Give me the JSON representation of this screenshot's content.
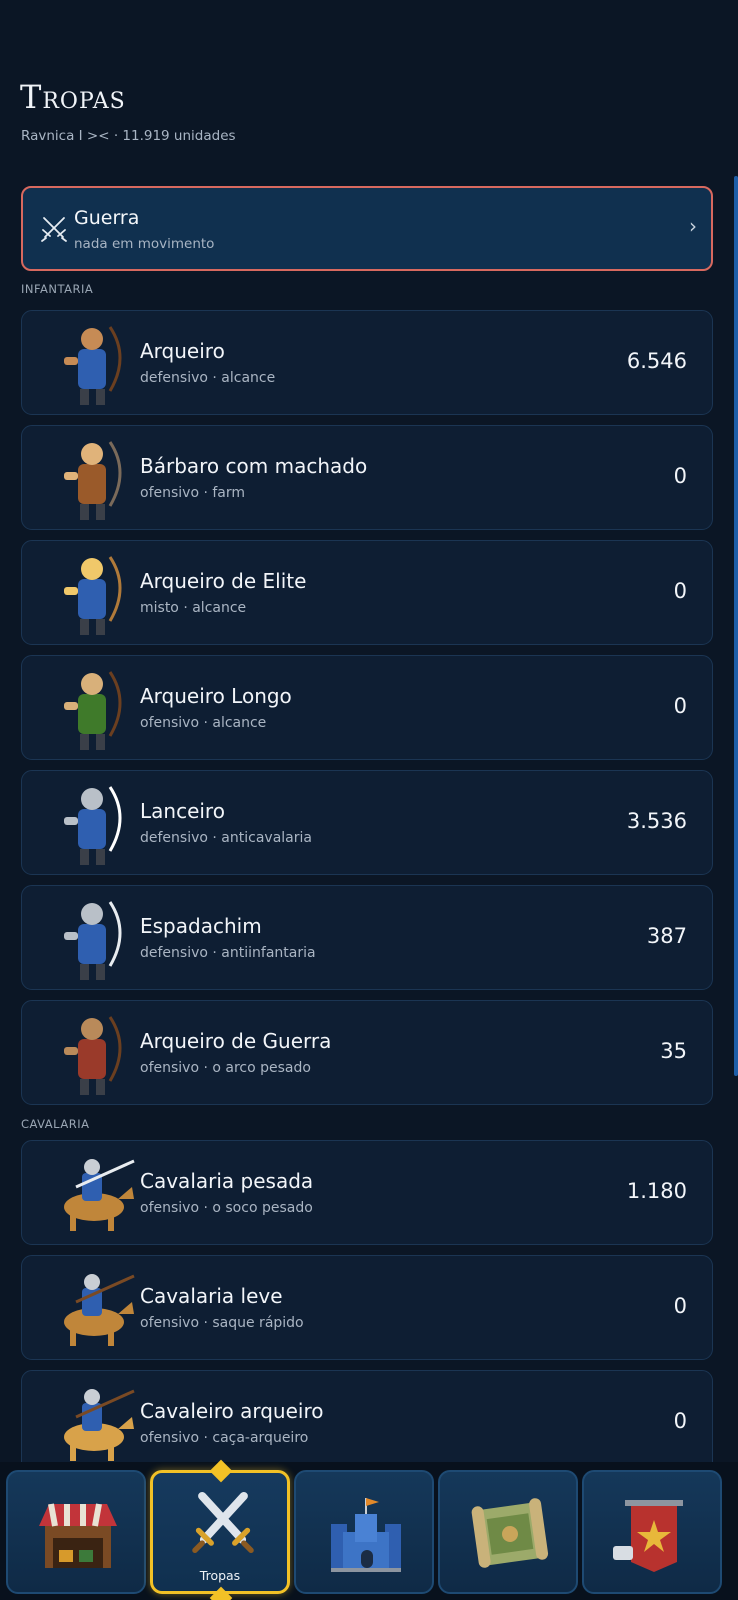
{
  "header": {
    "title": "Tropas",
    "subtitle": "Ravnica I >< · 11.919 unidades"
  },
  "war": {
    "title": "Guerra",
    "subtitle": "nada em movimento",
    "icon": "crossed-swords-icon"
  },
  "sections": {
    "infantry": "INFANTARIA",
    "cavalry": "CAVALARIA"
  },
  "troops": [
    {
      "name": "Arqueiro",
      "desc": "defensivo · alcance",
      "count": "6.546",
      "icon": "archer-icon"
    },
    {
      "name": "Bárbaro com machado",
      "desc": "ofensivo · farm",
      "count": "0",
      "icon": "axe-barbarian-icon"
    },
    {
      "name": "Arqueiro de Elite",
      "desc": "misto · alcance",
      "count": "0",
      "icon": "elite-archer-icon"
    },
    {
      "name": "Arqueiro Longo",
      "desc": "ofensivo · alcance",
      "count": "0",
      "icon": "longbow-archer-icon"
    },
    {
      "name": "Lanceiro",
      "desc": "defensivo · anticavalaria",
      "count": "3.536",
      "icon": "spearman-icon"
    },
    {
      "name": "Espadachim",
      "desc": "defensivo · antiinfantaria",
      "count": "387",
      "icon": "swordsman-icon"
    },
    {
      "name": "Arqueiro de Guerra",
      "desc": "ofensivo · o arco pesado",
      "count": "35",
      "icon": "war-archer-icon"
    },
    {
      "name": "Cavalaria pesada",
      "desc": "ofensivo · o soco pesado",
      "count": "1.180",
      "icon": "heavy-cavalry-icon"
    },
    {
      "name": "Cavalaria leve",
      "desc": "ofensivo · saque rápido",
      "count": "0",
      "icon": "light-cavalry-icon"
    },
    {
      "name": "Cavaleiro arqueiro",
      "desc": "ofensivo · caça-arqueiro",
      "count": "0",
      "icon": "horse-archer-icon"
    }
  ],
  "nav": [
    {
      "label": "",
      "icon": "market-icon"
    },
    {
      "label": "Tropas",
      "icon": "crossed-swords-icon",
      "active": true
    },
    {
      "label": "",
      "icon": "castle-icon"
    },
    {
      "label": "",
      "icon": "map-scroll-icon"
    },
    {
      "label": "",
      "icon": "alliance-banner-icon"
    }
  ],
  "colors": {
    "background": "#0b1625",
    "war_border": "#d8695f",
    "active_nav": "#f2c126"
  }
}
